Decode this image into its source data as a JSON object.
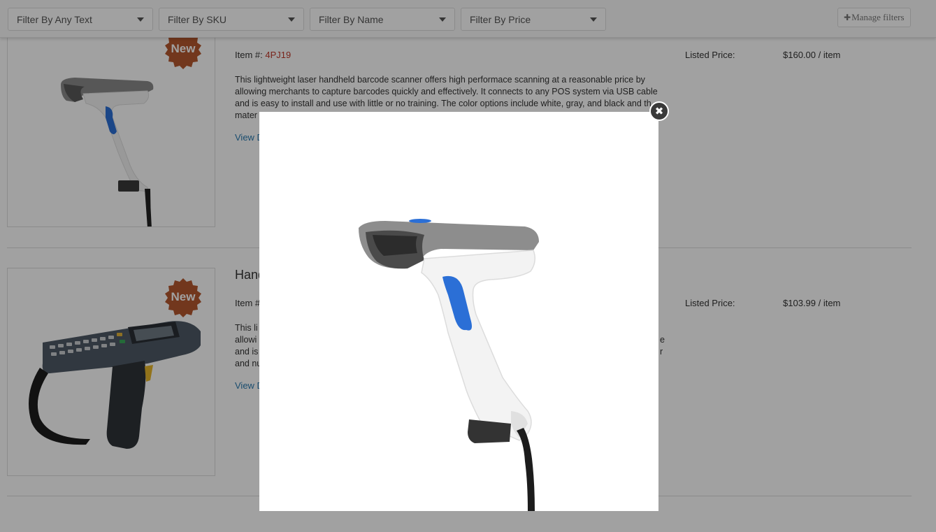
{
  "filters": {
    "any_text": "Filter By Any Text",
    "sku": "Filter By SKU",
    "name": "Filter By Name",
    "price": "Filter By Price",
    "manage": "Manage filters"
  },
  "products": [
    {
      "badge": "New",
      "title": "",
      "item_label": "Item #:",
      "sku": "4PJ19",
      "description": "This lightweight laser handheld barcode scanner offers high performace scanning at a reasonable price by allowing merchants to capture barcodes quickly and effectively. It connects to any POS system via USB cable and is easy to install and use with little or no training. The color options include white, gray, and black and th mater",
      "view_link": "View D",
      "price_label": "Listed Price:",
      "price": "$160.00 / item"
    },
    {
      "badge": "New",
      "title": "Hand",
      "item_label": "Item #",
      "sku": "",
      "description_lines": [
        "This li",
        "allowi",
        "and is",
        "and nu"
      ],
      "description_tail": [
        "e",
        "r"
      ],
      "view_link": "View D",
      "price_label": "Listed Price:",
      "price": "$103.99 / item"
    }
  ],
  "modal": {
    "close_icon": "close-icon",
    "image": "barcode-scanner-image"
  },
  "colors": {
    "badge": "#b5582e",
    "link": "#2a7ab0",
    "sku": "#c0392b",
    "overlay": "rgba(0,0,0,0.37)"
  }
}
